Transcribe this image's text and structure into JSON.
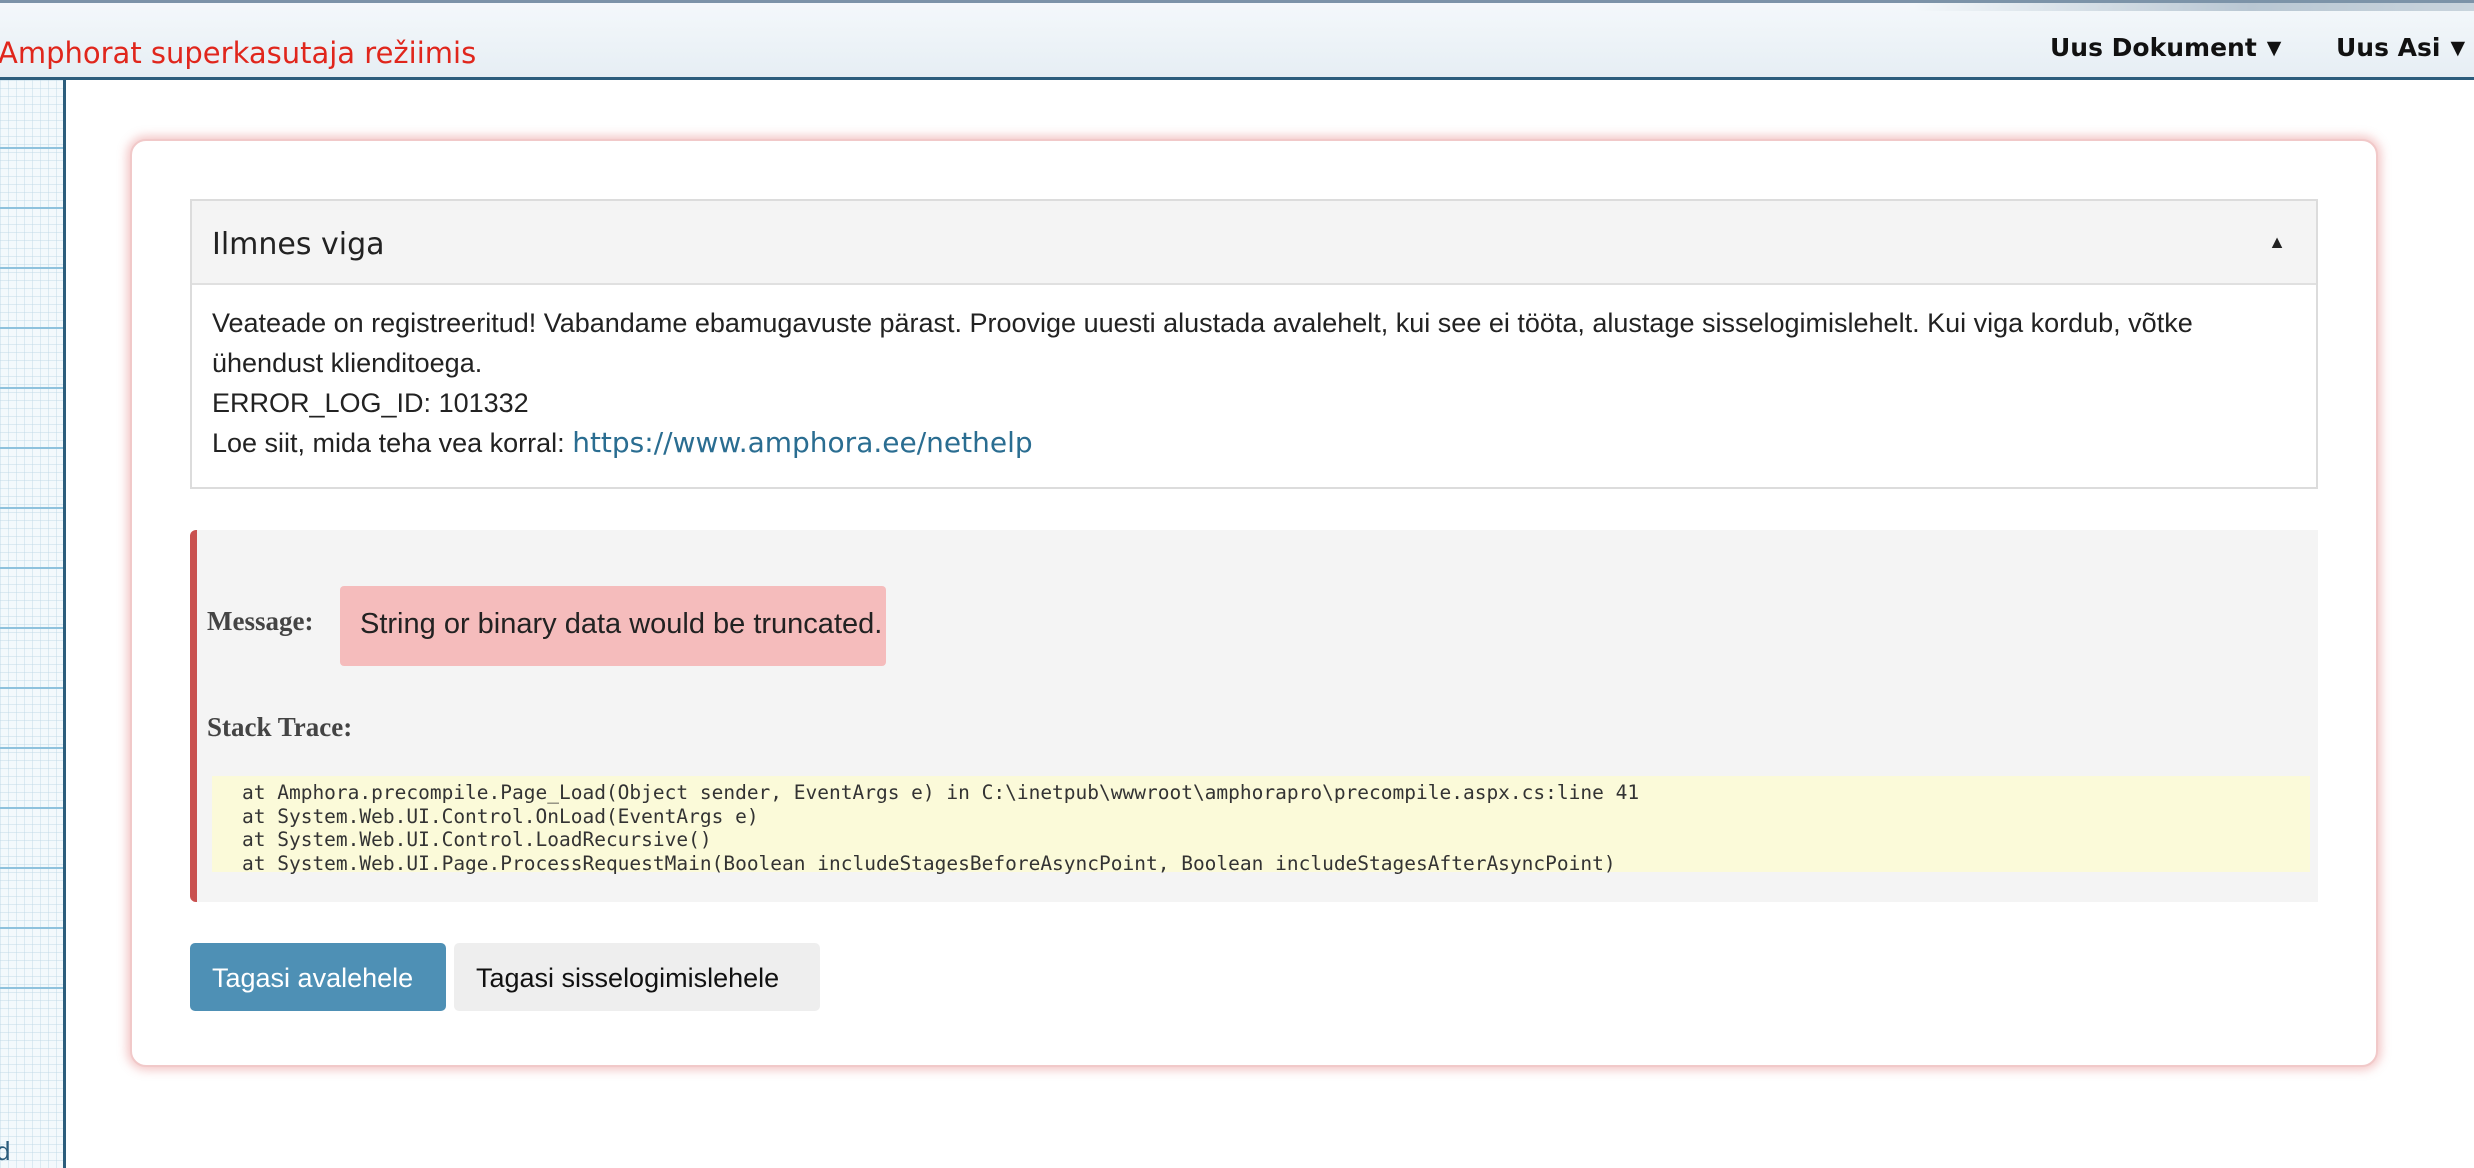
{
  "header": {
    "mode_label": "Amphorat superkasutaja režiimis",
    "menu": [
      {
        "label": "Uus Dokument"
      },
      {
        "label": "Uus Asi"
      }
    ]
  },
  "sidebar": {
    "letter": "d"
  },
  "error_panel": {
    "title": "Ilmnes viga",
    "description": "Veateade on registreeritud! Vabandame ebamugavuste pärast. Proovige uuesti alustada avalehelt, kui see ei tööta, alustage sisselogimislehelt. Kui viga kordub, võtke ühendust klienditoega.",
    "log_id_label": "ERROR_LOG_ID:",
    "log_id": "101332",
    "help_text": "Loe siit, mida teha vea korral:",
    "help_link": "https://www.amphora.ee/nethelp"
  },
  "details": {
    "message_label": "Message:",
    "message": "String or binary data would be truncated.",
    "stack_label": "Stack Trace:",
    "stack_trace": [
      "at Amphora.precompile.Page_Load(Object sender, EventArgs e) in C:\\inetpub\\wwwroot\\amphorapro\\precompile.aspx.cs:line 41",
      "at System.Web.UI.Control.OnLoad(EventArgs e)",
      "at System.Web.UI.Control.LoadRecursive()",
      "at System.Web.UI.Page.ProcessRequestMain(Boolean includeStagesBeforeAsyncPoint, Boolean includeStagesAfterAsyncPoint)"
    ]
  },
  "buttons": {
    "home": "Tagasi avalehele",
    "login": "Tagasi sisselogimislehele"
  },
  "colors": {
    "accent_red": "#e0261c",
    "primary_button": "#4e90b5",
    "error_border": "#c9514f",
    "message_bg": "#f5bcbc",
    "stack_bg": "#fbfad9"
  }
}
